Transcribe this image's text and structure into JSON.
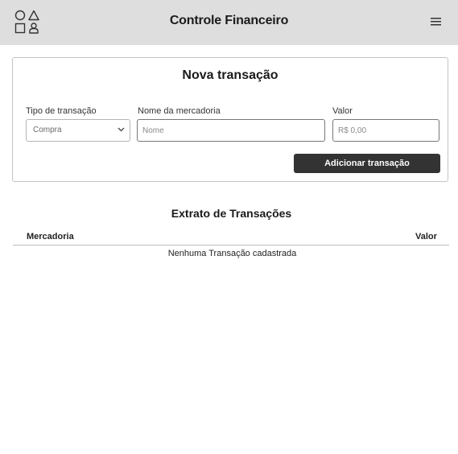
{
  "header": {
    "title": "Controle Financeiro",
    "logo_icon": "shapes-logo-icon",
    "menu_icon": "hamburger-menu-icon",
    "background": "#dedede"
  },
  "form": {
    "title": "Nova transação",
    "type_label": "Tipo de transação",
    "type_value": "Compra",
    "merchandise_label": "Nome da mercadoria",
    "merchandise_placeholder": "Nome",
    "value_label": "Valor",
    "value_placeholder": "R$ 0,00",
    "submit_label": "Adicionar transação",
    "submit_color": "#333333"
  },
  "statement": {
    "title": "Extrato de Transações",
    "columns": [
      "Mercadoria",
      "Valor"
    ],
    "empty_message": "Nenhuma Transação cadastrada"
  }
}
